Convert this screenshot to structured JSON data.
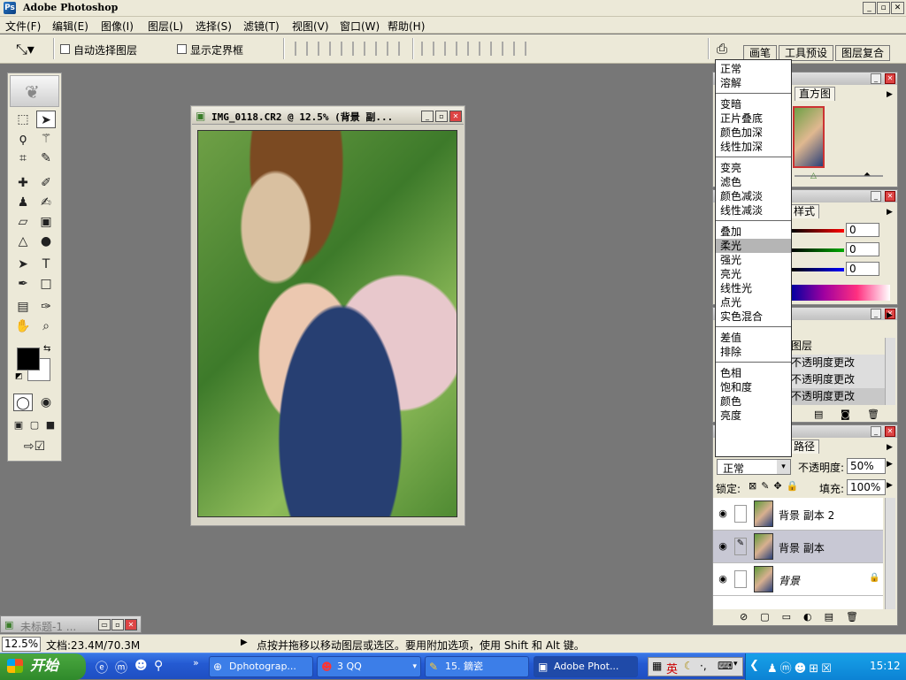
{
  "window": {
    "title": "Adobe Photoshop",
    "app_icon": "Ps"
  },
  "menubar": [
    "文件(F)",
    "编辑(E)",
    "图像(I)",
    "图层(L)",
    "选择(S)",
    "滤镜(T)",
    "视图(V)",
    "窗口(W)",
    "帮助(H)"
  ],
  "options": {
    "auto_select": "自动选择图层",
    "show_bounds": "显示定界框"
  },
  "palette_tabs": [
    "画笔",
    "工具预设",
    "图层复合"
  ],
  "document": {
    "title": "IMG_0118.CR2 @ 12.5% (背景 副...",
    "min_title": "未标题-1 ..."
  },
  "statusbar": {
    "zoom": "12.5%",
    "doc_size": "文档:23.4M/70.3M",
    "hint": "点按并拖移以移动图层或选区。要用附加选项，使用 Shift 和 Alt 键。"
  },
  "blend_menu": {
    "groups": [
      [
        "正常",
        "溶解"
      ],
      [
        "变暗",
        "正片叠底",
        "颜色加深",
        "线性加深"
      ],
      [
        "变亮",
        "滤色",
        "颜色减淡",
        "线性减淡"
      ],
      [
        "叠加",
        "柔光",
        "强光",
        "亮光",
        "线性光",
        "点光",
        "实色混合"
      ],
      [
        "差值",
        "排除"
      ],
      [
        "色相",
        "饱和度",
        "颜色",
        "亮度"
      ]
    ],
    "selected": "柔光"
  },
  "navigator": {
    "tab": "直方图"
  },
  "color": {
    "tab": "样式",
    "r": "0",
    "g": "0",
    "b": "0"
  },
  "history": {
    "items": [
      "图层",
      "不透明度更改",
      "不透明度更改",
      "不透明度更改"
    ]
  },
  "layers": {
    "tab": "路径",
    "blend_mode": "正常",
    "opacity_label": "不透明度:",
    "opacity": "50%",
    "lock_label": "锁定:",
    "fill_label": "填充:",
    "fill": "100%",
    "rows": [
      {
        "name": "背景 副本 2"
      },
      {
        "name": "背景 副本"
      },
      {
        "name": "背景"
      }
    ]
  },
  "taskbar": {
    "start": "开始",
    "buttons": [
      "Dphotograp...",
      "3 QQ",
      "15. 鏑瓷",
      "Adobe Phot..."
    ],
    "ime": "英",
    "clock": "15:12"
  }
}
